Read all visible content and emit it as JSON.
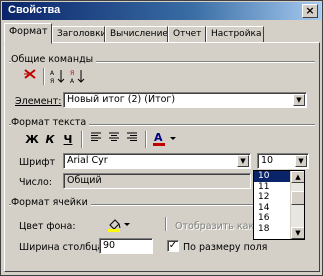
{
  "window": {
    "title": "Свойства",
    "close_label": "×"
  },
  "tabs": [
    {
      "label": "Формат",
      "active": true
    },
    {
      "label": "Заголовки",
      "active": false
    },
    {
      "label": "Вычисление",
      "active": false
    },
    {
      "label": "Отчет",
      "active": false
    },
    {
      "label": "Настройка",
      "active": false
    }
  ],
  "common": {
    "section_label": "Общие команды",
    "element_label": "Элемент:",
    "element_value": "Новый итог (2) (Итог)"
  },
  "text_format": {
    "section_label": "Формат текста",
    "bold": "Ж",
    "italic": "К",
    "underline": "Ч",
    "font_label": "Шрифт",
    "font_value": "Arial Cyr",
    "size_value": "10",
    "number_label": "Число:",
    "number_value": "Общий",
    "size_options": [
      "10",
      "11",
      "12",
      "14",
      "16",
      "18"
    ]
  },
  "cell_format": {
    "section_label": "Формат ячейки",
    "background_label": "Цвет фона:",
    "display_as_label": "Отобразить как",
    "column_width_label": "Ширина столбца:",
    "column_width_value": "90",
    "auto_width_label": "По размеру поля",
    "auto_width_checked": true
  }
}
